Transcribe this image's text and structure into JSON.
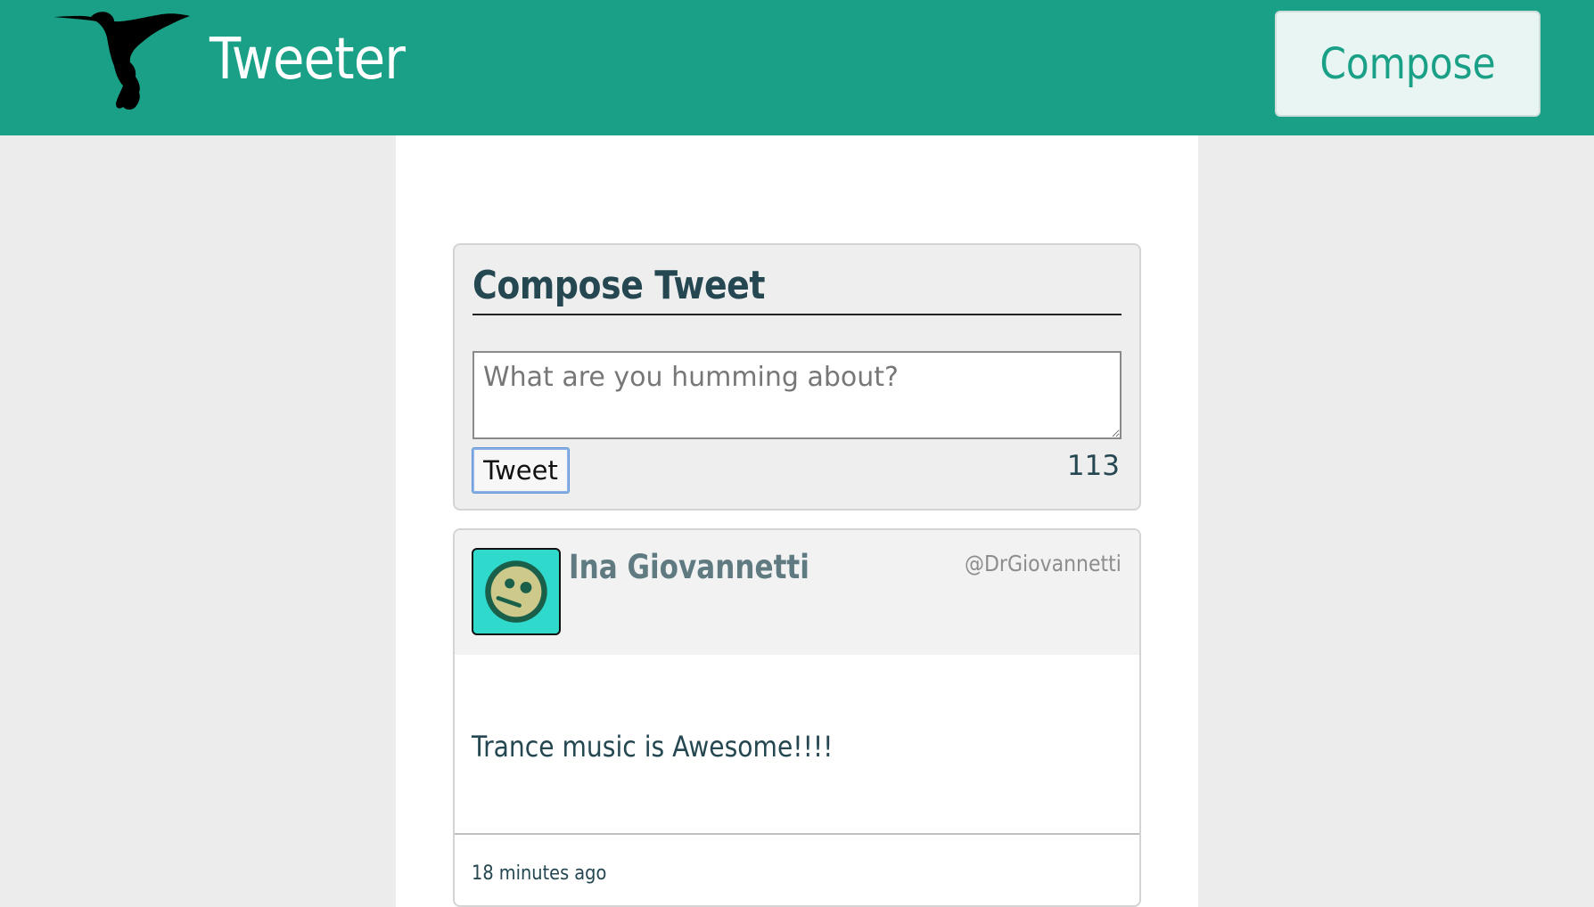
{
  "navbar": {
    "brand": "Tweeter",
    "compose_label": "Compose",
    "logo_icon": "hummingbird-icon",
    "background_color": "#1aa087"
  },
  "compose": {
    "title": "Compose Tweet",
    "placeholder": "What are you humming about?",
    "value": "",
    "submit_label": "Tweet",
    "counter": "113"
  },
  "tweets": [
    {
      "avatar_icon": "face-avatar-icon",
      "name": "Ina Giovannetti",
      "handle": "@DrGiovannetti",
      "content": "Trance music is Awesome!!!!",
      "time": "18 minutes ago"
    }
  ]
}
